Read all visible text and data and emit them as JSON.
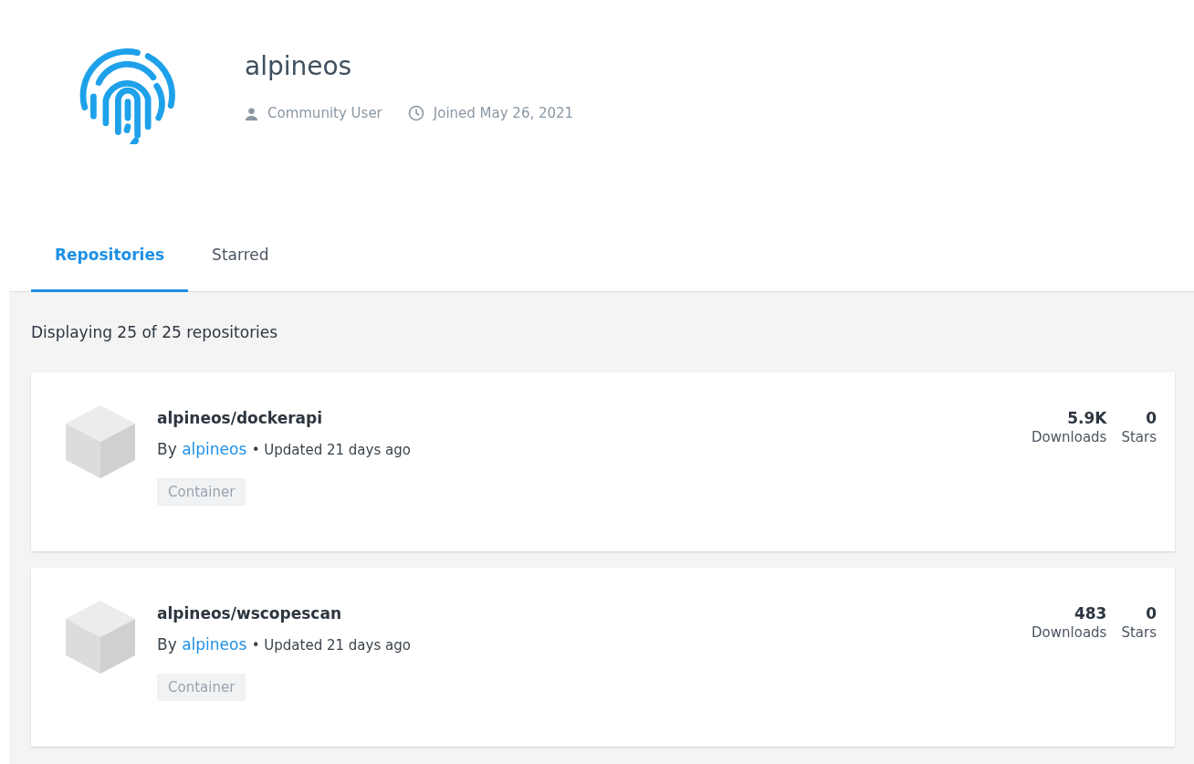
{
  "profile": {
    "name": "alpineos",
    "role": "Community User",
    "joined": "Joined May 26, 2021"
  },
  "tabs": [
    {
      "label": "Repositories",
      "selected": true
    },
    {
      "label": "Starred",
      "selected": false
    }
  ],
  "summary": "Displaying 25 of 25 repositories",
  "repositories": [
    {
      "name": "alpineos/dockerapi",
      "by_label": "By",
      "author": "alpineos",
      "separator": "•",
      "updated": "Updated 21 days ago",
      "tag": "Container",
      "downloads": "5.9K",
      "downloads_label": "Downloads",
      "stars_count": "0",
      "stars_label": "Stars"
    },
    {
      "name": "alpineos/wscopescan",
      "by_label": "By",
      "author": "alpineos",
      "separator": "•",
      "updated": "Updated 21 days ago",
      "tag": "Container",
      "downloads": "483",
      "downloads_label": "Downloads",
      "stars_count": "0",
      "stars_label": "Stars"
    }
  ]
}
